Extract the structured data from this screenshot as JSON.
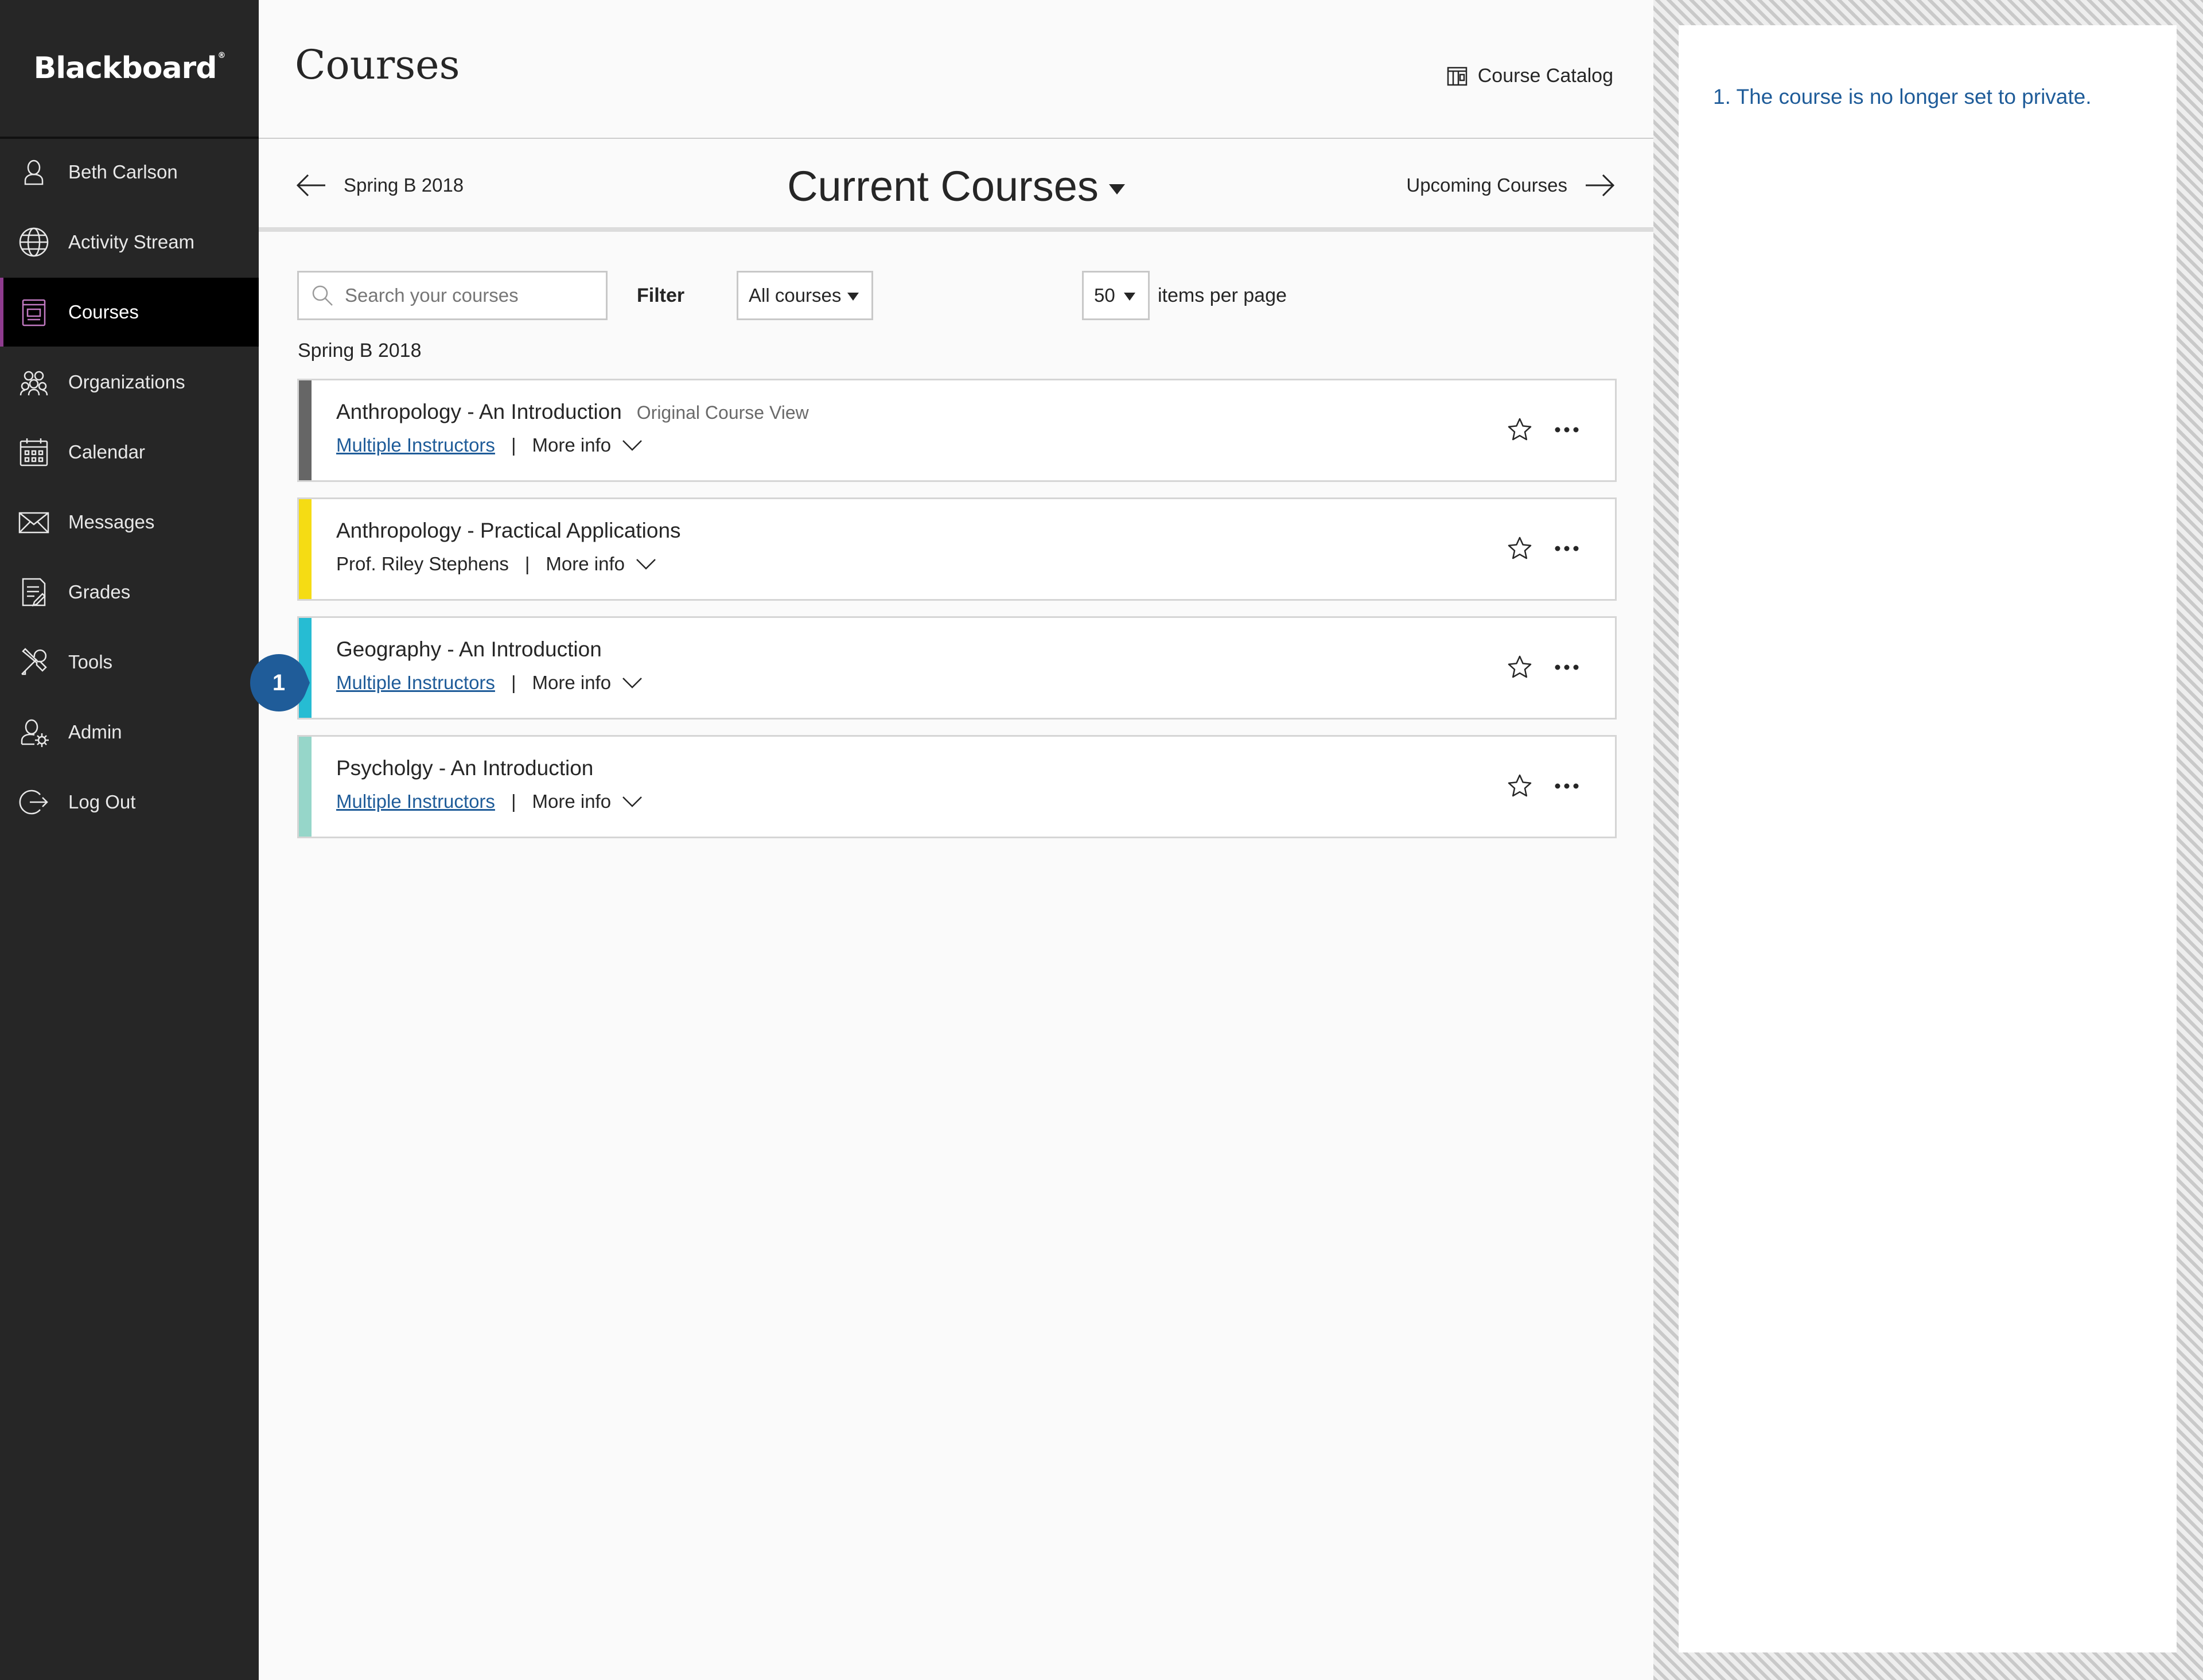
{
  "sidebar": {
    "logo": "Blackboard",
    "logo_mark": "®",
    "items": [
      {
        "label": "Beth Carlson",
        "icon": "user-icon"
      },
      {
        "label": "Activity Stream",
        "icon": "globe-icon"
      },
      {
        "label": "Courses",
        "icon": "courses-icon",
        "active": true
      },
      {
        "label": "Organizations",
        "icon": "organizations-icon"
      },
      {
        "label": "Calendar",
        "icon": "calendar-icon"
      },
      {
        "label": "Messages",
        "icon": "envelope-icon"
      },
      {
        "label": "Grades",
        "icon": "grades-icon"
      },
      {
        "label": "Tools",
        "icon": "tools-icon"
      },
      {
        "label": "Admin",
        "icon": "admin-icon"
      },
      {
        "label": "Log Out",
        "icon": "logout-icon"
      }
    ]
  },
  "header": {
    "title": "Courses",
    "catalog_label": "Course Catalog"
  },
  "term_bar": {
    "prev_label": "Spring B 2018",
    "title": "Current Courses",
    "next_label": "Upcoming Courses"
  },
  "toolbar": {
    "search_placeholder": "Search your courses",
    "filter_label": "Filter",
    "filter_value": "All courses",
    "per_page_value": "50",
    "per_page_label": "items per page"
  },
  "term_heading": "Spring B 2018",
  "courses": [
    {
      "title": "Anthropology - An Introduction",
      "view": "Original Course View",
      "instructor": "Multiple Instructors",
      "instructor_is_link": true,
      "more_info": "More info",
      "separator": "|",
      "color": "#666666"
    },
    {
      "title": "Anthropology - Practical Applications",
      "view": "",
      "instructor": "Prof. Riley Stephens",
      "instructor_is_link": false,
      "more_info": "More info",
      "separator": "|",
      "color": "#f5dc14"
    },
    {
      "title": "Geography - An Introduction",
      "view": "",
      "instructor": "Multiple Instructors",
      "instructor_is_link": true,
      "more_info": "More info",
      "separator": "|",
      "color": "#26bcd3"
    },
    {
      "title": "Psycholgy - An Introduction",
      "view": "",
      "instructor": "Multiple Instructors",
      "instructor_is_link": true,
      "more_info": "More info",
      "separator": "|",
      "color": "#96d6c9"
    }
  ],
  "callout": {
    "number": "1",
    "color": "#1f5c99"
  },
  "annotation": {
    "note": "1. The course is no longer set to private."
  },
  "colors": {
    "sidebar_bg": "#262626",
    "link": "#1f5c99",
    "active_accent": "#8e3b8e"
  }
}
